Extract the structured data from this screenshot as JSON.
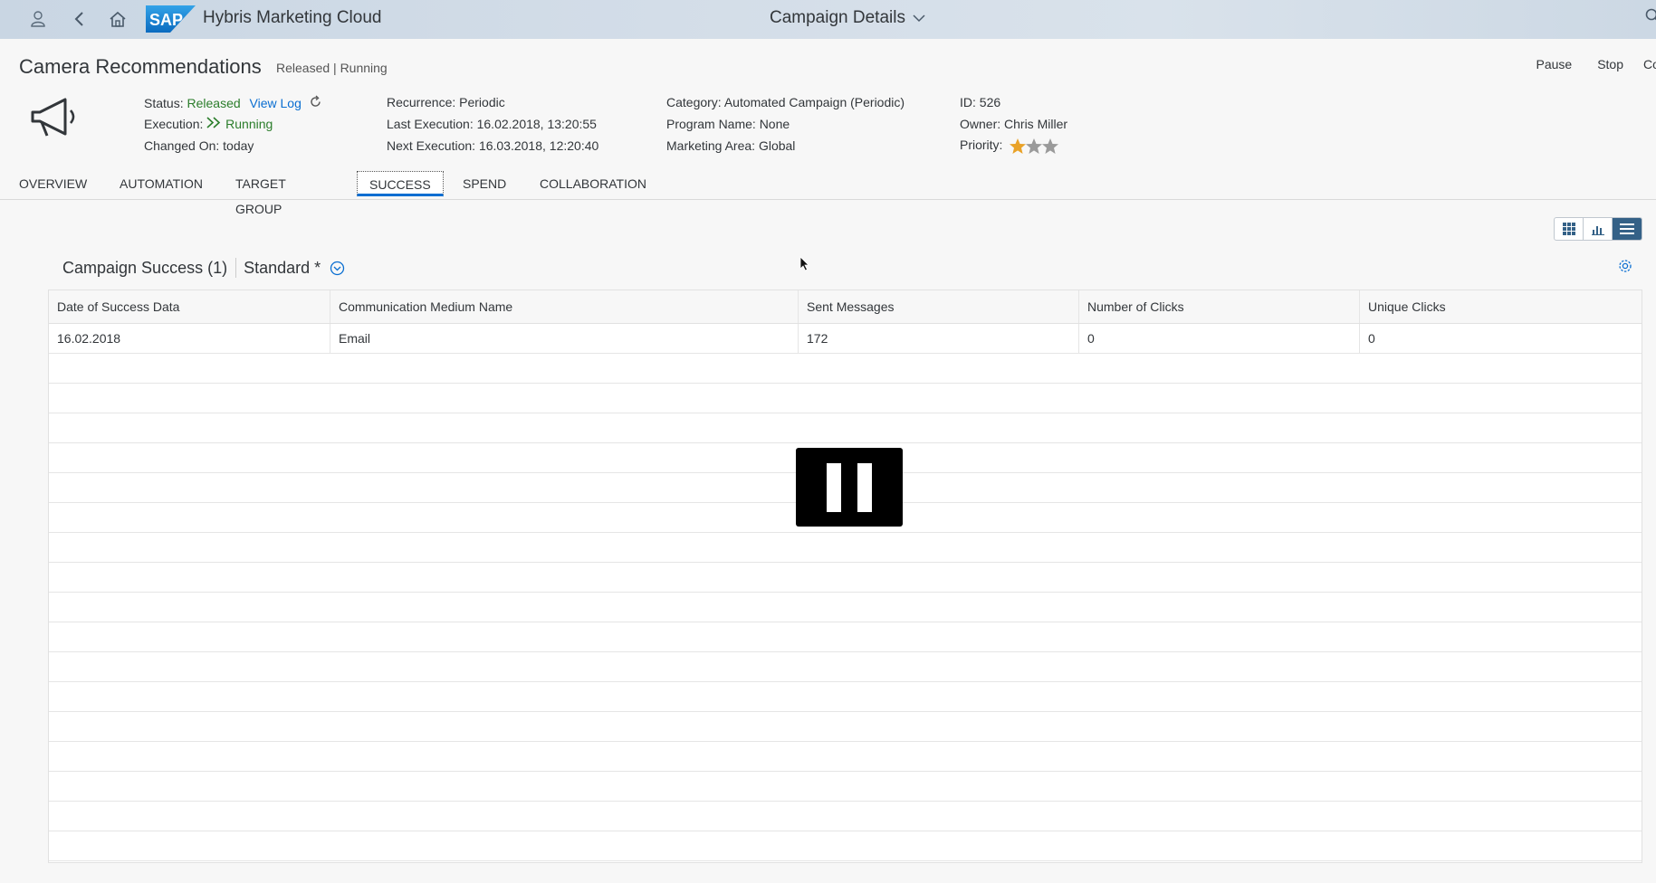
{
  "shell": {
    "app_name": "Hybris Marketing Cloud",
    "logo_text": "SAP",
    "page_title": "Campaign Details"
  },
  "header": {
    "title": "Camera Recommendations",
    "status_text": "Released | Running",
    "actions": [
      "Pause",
      "Stop",
      "Co"
    ],
    "col1": {
      "status_label": "Status:",
      "status_value": "Released",
      "view_log": "View Log",
      "execution_label": "Execution:",
      "execution_value": "Running",
      "changed_on": "Changed On: today"
    },
    "col2": {
      "recurrence": "Recurrence: Periodic",
      "last_execution": "Last Execution: 16.02.2018, 13:20:55",
      "next_execution": "Next Execution: 16.03.2018, 12:20:40"
    },
    "col3": {
      "category": "Category: Automated Campaign (Periodic)",
      "program": "Program Name: None",
      "area": "Marketing Area: Global"
    },
    "col4": {
      "id": "ID: 526",
      "owner": "Owner: Chris Miller",
      "priority_label": "Priority:",
      "priority_stars": 1,
      "priority_max": 3
    }
  },
  "tabs": [
    "OVERVIEW",
    "AUTOMATION",
    "TARGET GROUP",
    "SUCCESS",
    "SPEND",
    "COLLABORATION"
  ],
  "selected_tab": "SUCCESS",
  "table": {
    "title": "Campaign Success (1)",
    "variant": "Standard *",
    "columns": [
      "Date of Success Data",
      "Communication Medium Name",
      "Sent Messages",
      "Number of Clicks",
      "Unique Clicks"
    ],
    "rows": [
      [
        "16.02.2018",
        "Email",
        "172",
        "0",
        "0"
      ]
    ]
  },
  "colors": {
    "accent": "#0a6ed1",
    "positive": "#2b7d2b",
    "star": "#e9a228"
  }
}
